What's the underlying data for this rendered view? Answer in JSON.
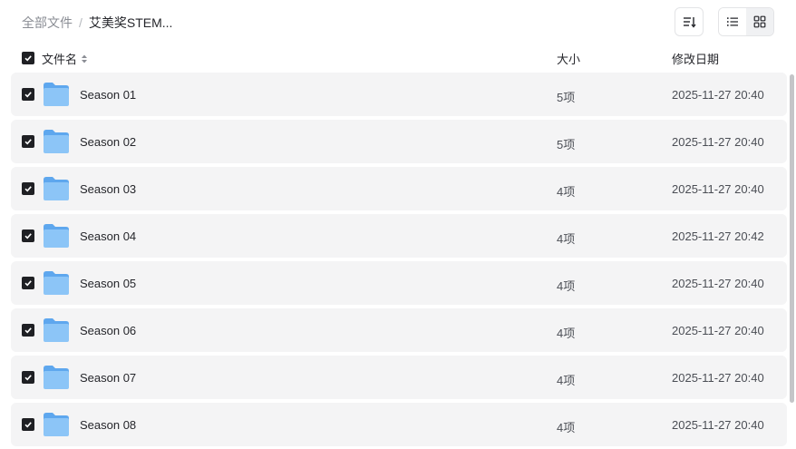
{
  "breadcrumb": {
    "root": "全部文件",
    "separator": "/",
    "current": "艾美奖STEM..."
  },
  "toolbar": {
    "sort_icon": "sort-icon",
    "list_view_icon": "list-view-icon",
    "grid_view_icon": "grid-view-icon",
    "active_view": "list"
  },
  "table": {
    "header": {
      "name": "文件名",
      "size": "大小",
      "modified": "修改日期"
    },
    "rows": [
      {
        "name": "Season 01",
        "size": "5项",
        "modified": "2025-11-27 20:40"
      },
      {
        "name": "Season 02",
        "size": "5项",
        "modified": "2025-11-27 20:40"
      },
      {
        "name": "Season 03",
        "size": "4项",
        "modified": "2025-11-27 20:40"
      },
      {
        "name": "Season 04",
        "size": "4项",
        "modified": "2025-11-27 20:42"
      },
      {
        "name": "Season 05",
        "size": "4项",
        "modified": "2025-11-27 20:40"
      },
      {
        "name": "Season 06",
        "size": "4项",
        "modified": "2025-11-27 20:40"
      },
      {
        "name": "Season 07",
        "size": "4项",
        "modified": "2025-11-27 20:40"
      },
      {
        "name": "Season 08",
        "size": "4项",
        "modified": "2025-11-27 20:40"
      }
    ]
  },
  "colors": {
    "checkbox": "#1f2024",
    "row_background": "#f4f4f5",
    "folder": "#6fb1f0"
  }
}
